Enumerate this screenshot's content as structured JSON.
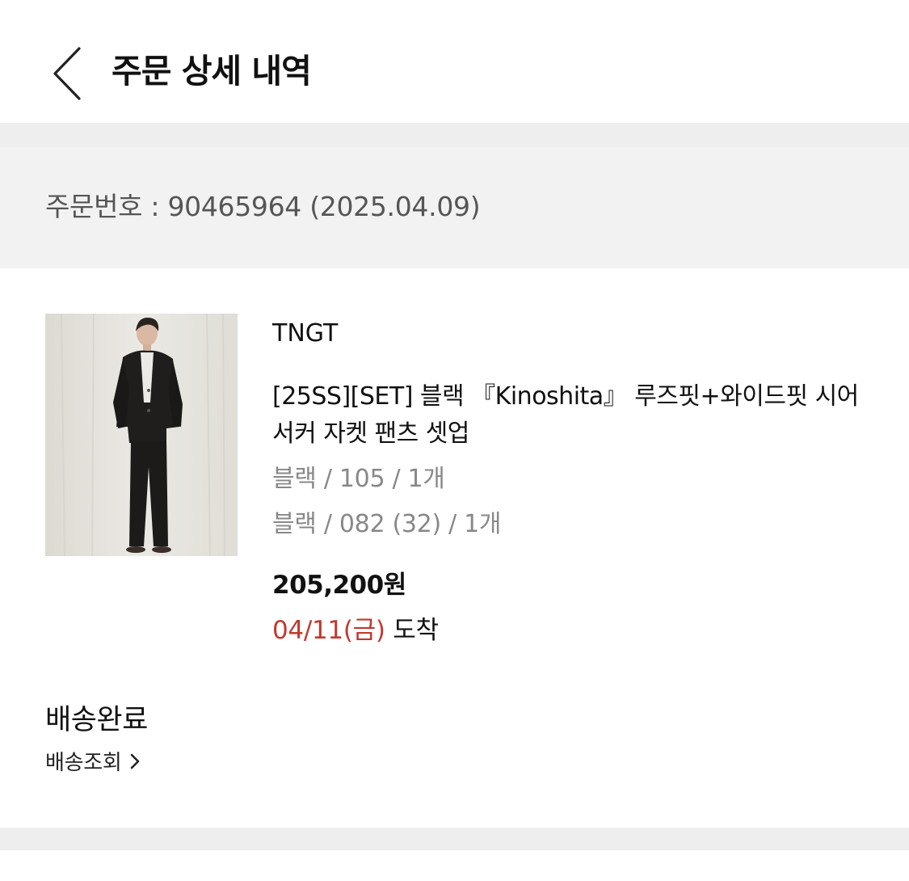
{
  "header": {
    "title": "주문 상세 내역",
    "back_icon": "chevron-left-icon"
  },
  "order": {
    "number_text": "주문번호 : 90465964 (2025.04.09)"
  },
  "product": {
    "image_icon": "product-photo",
    "brand": "TNGT",
    "name": "[25SS][SET] 블랙 『Kinoshita』 루즈핏+와이드핏 시어서커 자켓 팬츠 셋업",
    "options": [
      "블랙 / 105 / 1개",
      "블랙 / 082 (32) / 1개"
    ],
    "price": "205,200원",
    "arrival_date": "04/11(금)",
    "arrival_suffix": "도착"
  },
  "delivery": {
    "status": "배송완료",
    "tracking_label": "배송조회",
    "tracking_icon": "chevron-right-icon"
  },
  "colors": {
    "arrival_date": "#c0392f",
    "divider": "#eeeeee",
    "order_bar": "#f2f2f2",
    "muted_text": "#888888"
  }
}
